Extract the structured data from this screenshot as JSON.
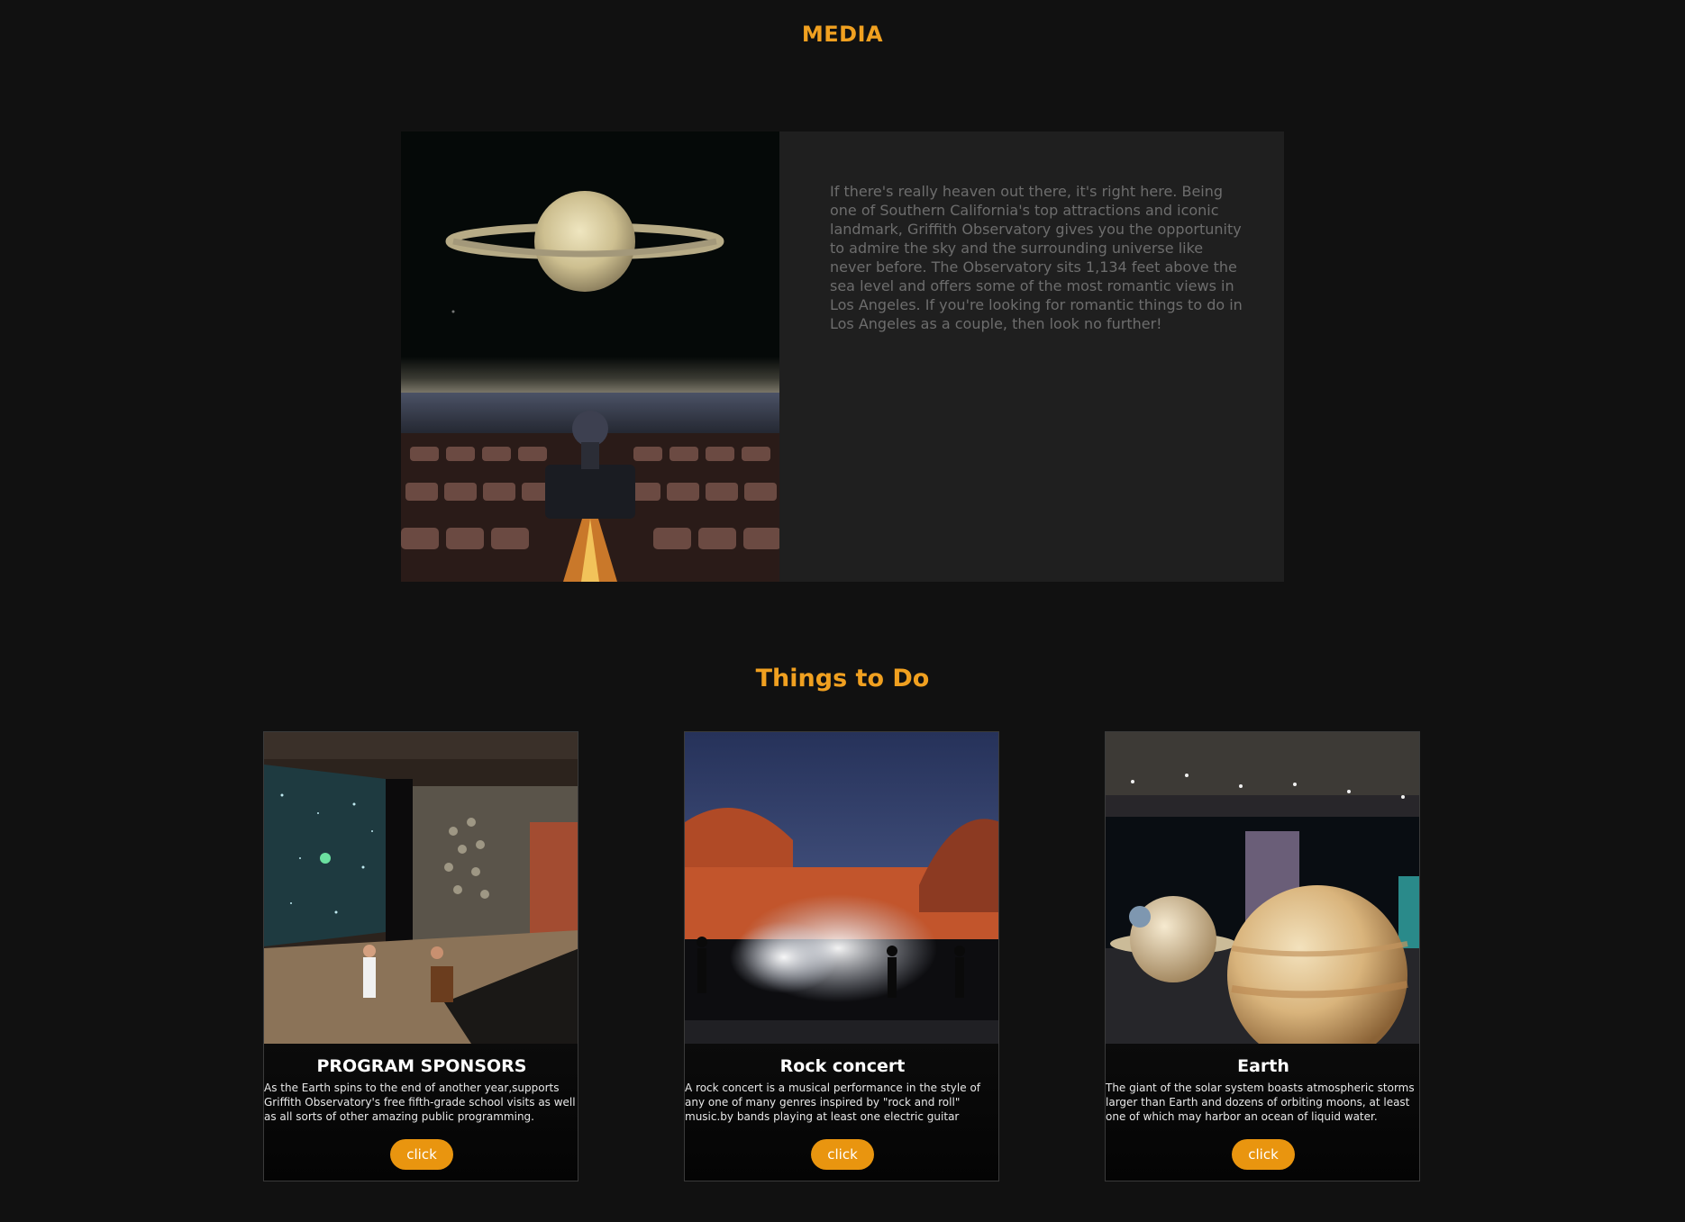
{
  "media": {
    "title": "MEDIA",
    "text": "If there's really heaven out there, it's right here. Being one of Southern California's top attractions and iconic landmark, Griffith Observatory gives you the opportunity to admire the sky and the surrounding universe like never before. The Observatory sits 1,134 feet above the sea level and offers some of the most romantic views in Los Angeles. If you're looking for romantic things to do in Los Angeles as a couple, then look no further!"
  },
  "things": {
    "title": "Things to Do",
    "cards": [
      {
        "title": "PROGRAM SPONSORS",
        "description": "As the Earth spins to the end of another year,supports Griffith Observatory's free fifth-grade school visits as well as all sorts of other amazing public programming.",
        "button": "click"
      },
      {
        "title": "Rock concert",
        "description": "A rock concert is a musical performance in the style of any one of many genres inspired by \"rock and roll\" music.by bands playing at least one electric guitar",
        "button": "click"
      },
      {
        "title": "Earth",
        "description": "The giant of the solar system boasts atmospheric storms larger than Earth and dozens of orbiting moons, at least one of which may harbor an ocean of liquid water.",
        "button": "click"
      }
    ]
  },
  "colors": {
    "background": "#111111",
    "accent": "#f0a020",
    "panel": "#1f1f1f",
    "button": "#e9950f"
  }
}
